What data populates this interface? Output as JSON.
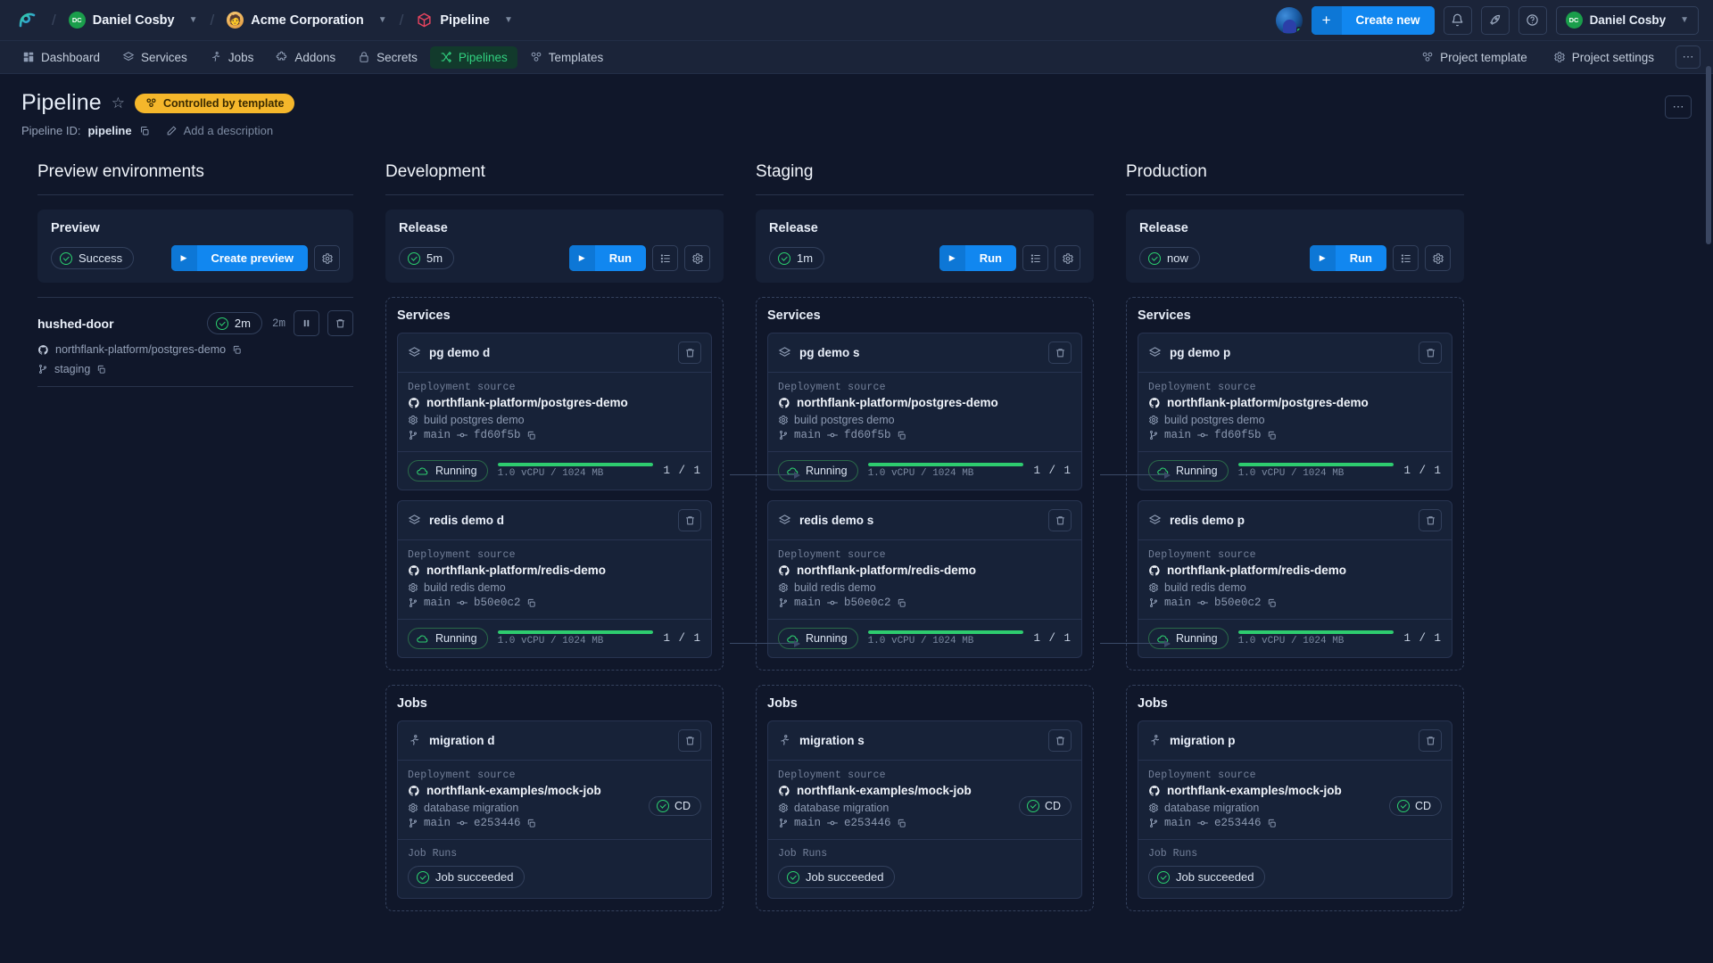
{
  "topbar": {
    "breadcrumbs": [
      {
        "label": "Daniel Cosby",
        "avatar_initials": "DC",
        "avatar_type": "green"
      },
      {
        "label": "Acme Corporation",
        "avatar_type": "acme"
      },
      {
        "label": "Pipeline",
        "avatar_type": "pipeline"
      }
    ],
    "create_new_label": "Create new",
    "plus_label": "+",
    "icons": [
      "bell-icon",
      "rocket-icon",
      "help-icon"
    ],
    "user_name": "Daniel Cosby",
    "user_initials": "DC"
  },
  "nav": {
    "items": [
      {
        "label": "Dashboard",
        "icon": "grid-icon",
        "active": false
      },
      {
        "label": "Services",
        "icon": "layers-icon",
        "active": false
      },
      {
        "label": "Jobs",
        "icon": "runner-icon",
        "active": false
      },
      {
        "label": "Addons",
        "icon": "puzzle-icon",
        "active": false
      },
      {
        "label": "Secrets",
        "icon": "lock-icon",
        "active": false
      },
      {
        "label": "Pipelines",
        "icon": "shuffle-icon",
        "active": true
      },
      {
        "label": "Templates",
        "icon": "template-icon",
        "active": false
      }
    ],
    "right": [
      {
        "label": "Project template",
        "icon": "template-icon"
      },
      {
        "label": "Project settings",
        "icon": "gear-icon"
      }
    ],
    "overflow_label": "⋯"
  },
  "page": {
    "title": "Pipeline",
    "template_badge": "Controlled by template",
    "id_label": "Pipeline ID:",
    "id_value": "pipeline",
    "description_placeholder": "Add a description",
    "overflow_label": "⋯"
  },
  "colors": {
    "accent_blue": "#1187f0",
    "success_green": "#2ecc6f",
    "template_yellow": "#f5b72b",
    "active_tab_green": "#31d07f"
  },
  "columns": [
    {
      "title": "Preview environments",
      "release": {
        "title": "Preview",
        "status": "Success",
        "button_label": "Create preview",
        "settings_icon": "gear-icon"
      },
      "preview_envs": [
        {
          "name": "hushed-door",
          "status": "2m",
          "age": "2m",
          "repo": "northflank-platform/postgres-demo",
          "branch": "staging"
        }
      ]
    },
    {
      "title": "Development",
      "release": {
        "title": "Release",
        "status": "5m",
        "button_label": "Run",
        "list_icon": "list-icon",
        "settings_icon": "gear-icon"
      },
      "services_group": {
        "title": "Services",
        "items": [
          {
            "name": "pg demo d",
            "icon": "layers-icon",
            "source_label": "Deployment source",
            "repo": "northflank-platform/postgres-demo",
            "build": "build postgres demo",
            "branch": "main",
            "commit": "fd60f5b",
            "status": "Running",
            "resources": "1.0 vCPU / 1024 MB",
            "progress": 100,
            "replicas": "1 / 1"
          },
          {
            "name": "redis demo d",
            "icon": "layers-icon",
            "source_label": "Deployment source",
            "repo": "northflank-platform/redis-demo",
            "build": "build redis demo",
            "branch": "main",
            "commit": "b50e0c2",
            "status": "Running",
            "resources": "1.0 vCPU / 1024 MB",
            "progress": 100,
            "replicas": "1 / 1"
          }
        ]
      },
      "jobs_group": {
        "title": "Jobs",
        "items": [
          {
            "name": "migration d",
            "icon": "runner-icon",
            "source_label": "Deployment source",
            "repo": "northflank-examples/mock-job",
            "build": "database migration",
            "branch": "main",
            "commit": "e253446",
            "cd_badge": "CD",
            "runs_label": "Job Runs",
            "run_status": "Job succeeded"
          }
        ]
      }
    },
    {
      "title": "Staging",
      "release": {
        "title": "Release",
        "status": "1m",
        "button_label": "Run",
        "list_icon": "list-icon",
        "settings_icon": "gear-icon"
      },
      "services_group": {
        "title": "Services",
        "items": [
          {
            "name": "pg demo s",
            "icon": "layers-icon",
            "source_label": "Deployment source",
            "repo": "northflank-platform/postgres-demo",
            "build": "build postgres demo",
            "branch": "main",
            "commit": "fd60f5b",
            "status": "Running",
            "resources": "1.0 vCPU / 1024 MB",
            "progress": 100,
            "replicas": "1 / 1"
          },
          {
            "name": "redis demo s",
            "icon": "layers-icon",
            "source_label": "Deployment source",
            "repo": "northflank-platform/redis-demo",
            "build": "build redis demo",
            "branch": "main",
            "commit": "b50e0c2",
            "status": "Running",
            "resources": "1.0 vCPU / 1024 MB",
            "progress": 100,
            "replicas": "1 / 1"
          }
        ]
      },
      "jobs_group": {
        "title": "Jobs",
        "items": [
          {
            "name": "migration s",
            "icon": "runner-icon",
            "source_label": "Deployment source",
            "repo": "northflank-examples/mock-job",
            "build": "database migration",
            "branch": "main",
            "commit": "e253446",
            "cd_badge": "CD",
            "runs_label": "Job Runs",
            "run_status": "Job succeeded"
          }
        ]
      }
    },
    {
      "title": "Production",
      "release": {
        "title": "Release",
        "status": "now",
        "button_label": "Run",
        "list_icon": "list-icon",
        "settings_icon": "gear-icon"
      },
      "services_group": {
        "title": "Services",
        "items": [
          {
            "name": "pg demo p",
            "icon": "layers-icon",
            "source_label": "Deployment source",
            "repo": "northflank-platform/postgres-demo",
            "build": "build postgres demo",
            "branch": "main",
            "commit": "fd60f5b",
            "status": "Running",
            "resources": "1.0 vCPU / 1024 MB",
            "progress": 100,
            "replicas": "1 / 1"
          },
          {
            "name": "redis demo p",
            "icon": "layers-icon",
            "source_label": "Deployment source",
            "repo": "northflank-platform/redis-demo",
            "build": "build redis demo",
            "branch": "main",
            "commit": "b50e0c2",
            "status": "Running",
            "resources": "1.0 vCPU / 1024 MB",
            "progress": 100,
            "replicas": "1 / 1"
          }
        ]
      },
      "jobs_group": {
        "title": "Jobs",
        "items": [
          {
            "name": "migration p",
            "icon": "runner-icon",
            "source_label": "Deployment source",
            "repo": "northflank-examples/mock-job",
            "build": "database migration",
            "branch": "main",
            "commit": "e253446",
            "cd_badge": "CD",
            "runs_label": "Job Runs",
            "run_status": "Job succeeded"
          }
        ]
      }
    }
  ]
}
